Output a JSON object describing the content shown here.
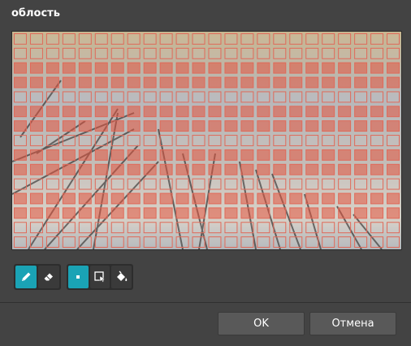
{
  "dialog": {
    "title": "облость"
  },
  "canvas": {
    "grid_columns": 24,
    "grid_rows": 15,
    "cell_outline_color": "#e06a5a",
    "selected_cell_color": "#e4553f",
    "selected_rows": [
      2,
      3,
      5,
      6,
      8,
      9,
      11,
      12
    ]
  },
  "toolbar": {
    "pencil_tool": {
      "icon": "pencil-icon",
      "active": true
    },
    "eraser_tool": {
      "icon": "eraser-icon",
      "active": false
    },
    "point_tool": {
      "icon": "point-icon",
      "active": true
    },
    "select_tool": {
      "icon": "rect-select-icon",
      "active": false
    },
    "fill_tool": {
      "icon": "paint-bucket-icon",
      "active": false
    },
    "accent_color": "#1aa3b5"
  },
  "buttons": {
    "ok_label": "OK",
    "cancel_label": "Отмена"
  }
}
